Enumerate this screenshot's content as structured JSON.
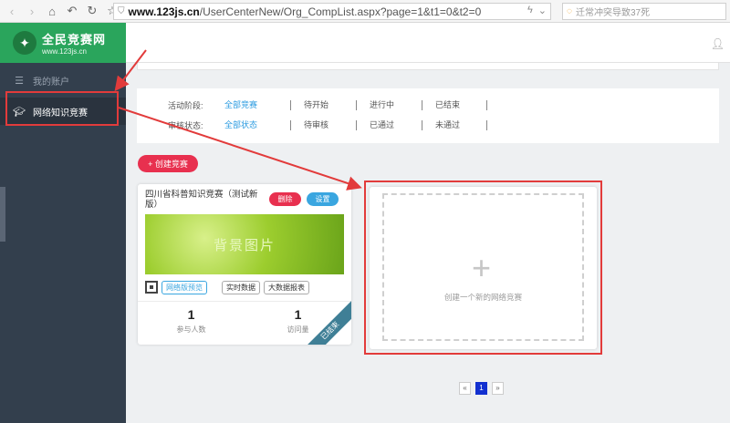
{
  "browser": {
    "url_host": "www.123js.cn",
    "url_path": "/UserCenterNew/Org_CompList.aspx?page=1&t1=0&t2=0",
    "search_placeholder": "迁常冲突导致37死"
  },
  "sidebar": {
    "logo_name": "全民竞赛网",
    "logo_url": "www.123js.cn",
    "items": [
      {
        "label": "我的账户",
        "icon": "database-icon"
      },
      {
        "label": "网络知识竞赛",
        "icon": "graduation-cap-icon"
      }
    ]
  },
  "filters": {
    "stage_label": "活动阶段:",
    "stage_options": [
      "全部竞赛",
      "待开始",
      "进行中",
      "已结束"
    ],
    "review_label": "审核状态:",
    "review_options": [
      "全部状态",
      "待审核",
      "已通过",
      "未通过"
    ]
  },
  "actions": {
    "create_label": "+ 创建竞赛"
  },
  "competition": {
    "title": "四川省科普知识竞赛（测试新版）",
    "delete_label": "删除",
    "settings_label": "设置",
    "banner_text": "背景图片",
    "tools": [
      "网络版预览",
      "实时数据",
      "大数据报表"
    ],
    "participants_value": "1",
    "participants_label": "参与人数",
    "visits_value": "1",
    "visits_label": "访问量",
    "status_ribbon": "已结束"
  },
  "new_card": {
    "plus": "+",
    "text": "创建一个新的网络竞赛"
  },
  "pager": {
    "prev": "«",
    "current": "1",
    "next": "»"
  },
  "colors": {
    "sidebar": "#333f4d",
    "logo_bg": "#2aa55c",
    "accent_red": "#e8304f",
    "accent_blue": "#3aa6e0",
    "highlight": "#e23b3b"
  }
}
